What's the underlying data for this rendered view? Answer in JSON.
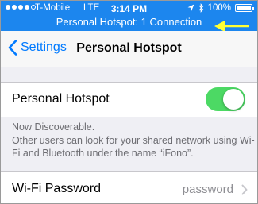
{
  "status_bar": {
    "carrier": "T-Mobile",
    "network": "LTE",
    "time": "3:14 PM",
    "battery": "100%",
    "signal_bars_filled": 4,
    "signal_bars_total": 5
  },
  "hotspot_banner": "Personal Hotspot: 1 Connection",
  "nav": {
    "back_label": "Settings",
    "title": "Personal Hotspot"
  },
  "hotspot_toggle": {
    "label": "Personal Hotspot",
    "on": true
  },
  "discoverable_text": "Now Discoverable.",
  "info_text_line1": "Other users can look for your shared network using Wi-",
  "info_text_line2": "Fi and Bluetooth under the name “iFono”.",
  "wifi_password": {
    "label": "Wi-Fi Password",
    "value": "password"
  },
  "colors": {
    "accent": "#007aff",
    "hotspot_bar": "#1c86ee",
    "toggle_on": "#4cd964",
    "arrow": "#ffff33"
  }
}
